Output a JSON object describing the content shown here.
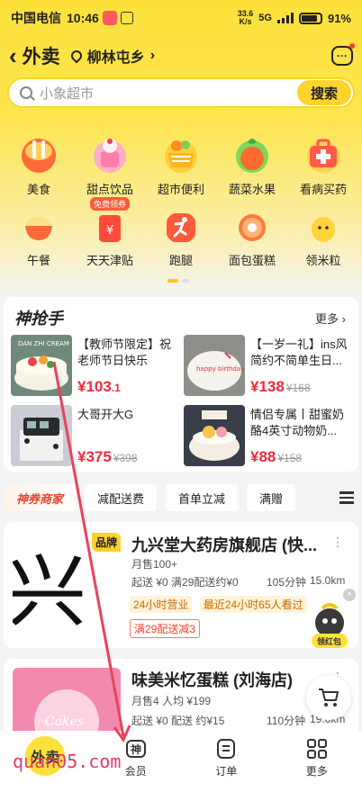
{
  "status": {
    "carrier": "中国电信",
    "time": "10:46",
    "netspeed": "33.6\nK/s",
    "net": "5G",
    "battery": "91%"
  },
  "header": {
    "back": "‹",
    "title": "外卖",
    "location": "柳林屯乡",
    "msg_icon": "···"
  },
  "search": {
    "placeholder": "小象超市",
    "button": "搜索"
  },
  "categories": [
    {
      "label": "美食"
    },
    {
      "label": "甜点饮品"
    },
    {
      "label": "超市便利"
    },
    {
      "label": "蔬菜水果"
    },
    {
      "label": "看病买药"
    },
    {
      "label": "午餐"
    },
    {
      "label": "天天津贴",
      "badge": "免费领券"
    },
    {
      "label": "跑腿"
    },
    {
      "label": "面包蛋糕"
    },
    {
      "label": "领米粒"
    }
  ],
  "flash": {
    "title": "神抢手",
    "more": "更多",
    "products": [
      {
        "name": "【教师节限定】祝老师节日快乐",
        "price": "¥103",
        "price_dec": ".1",
        "orig": ""
      },
      {
        "name": "【一岁一礼】ins风简约不简单生日...",
        "price": "¥138",
        "price_dec": "",
        "orig": "¥168"
      },
      {
        "name": "大哥开大G",
        "price": "¥375",
        "price_dec": "",
        "orig": "¥398"
      },
      {
        "name": "情侣专属丨甜蜜奶酪4英寸动物奶...",
        "price": "¥88",
        "price_dec": "",
        "orig": "¥158"
      }
    ]
  },
  "filters": [
    "神券商家",
    "减配送费",
    "首单立减",
    "满赠"
  ],
  "stores": [
    {
      "name": "九兴堂大药房旗舰店 (快...",
      "badge": "品牌",
      "sales": "月售100+",
      "delivery": "起送 ¥0  满29配送约¥0",
      "time": "105分钟",
      "distance": "15.0km",
      "tags": [
        "24小时营业",
        "最近24小时65人看过"
      ],
      "promo": "满29配送减3"
    },
    {
      "name": "味美米忆蛋糕 (刘海店)",
      "sales": "月售4  人均 ¥199",
      "delivery": "起送 ¥0  配送 约¥15",
      "time": "110分钟",
      "distance": "19.6km"
    }
  ],
  "fab": {
    "close": "×",
    "label": "领红包"
  },
  "tabbar": [
    {
      "label": "外卖"
    },
    {
      "label": "会员"
    },
    {
      "label": "订单"
    },
    {
      "label": "更多"
    }
  ],
  "watermark": "quan05.com",
  "colors": {
    "brand_yellow": "#fde13a",
    "price_red": "#f0293b",
    "promo_orange": "#ff8a00"
  }
}
